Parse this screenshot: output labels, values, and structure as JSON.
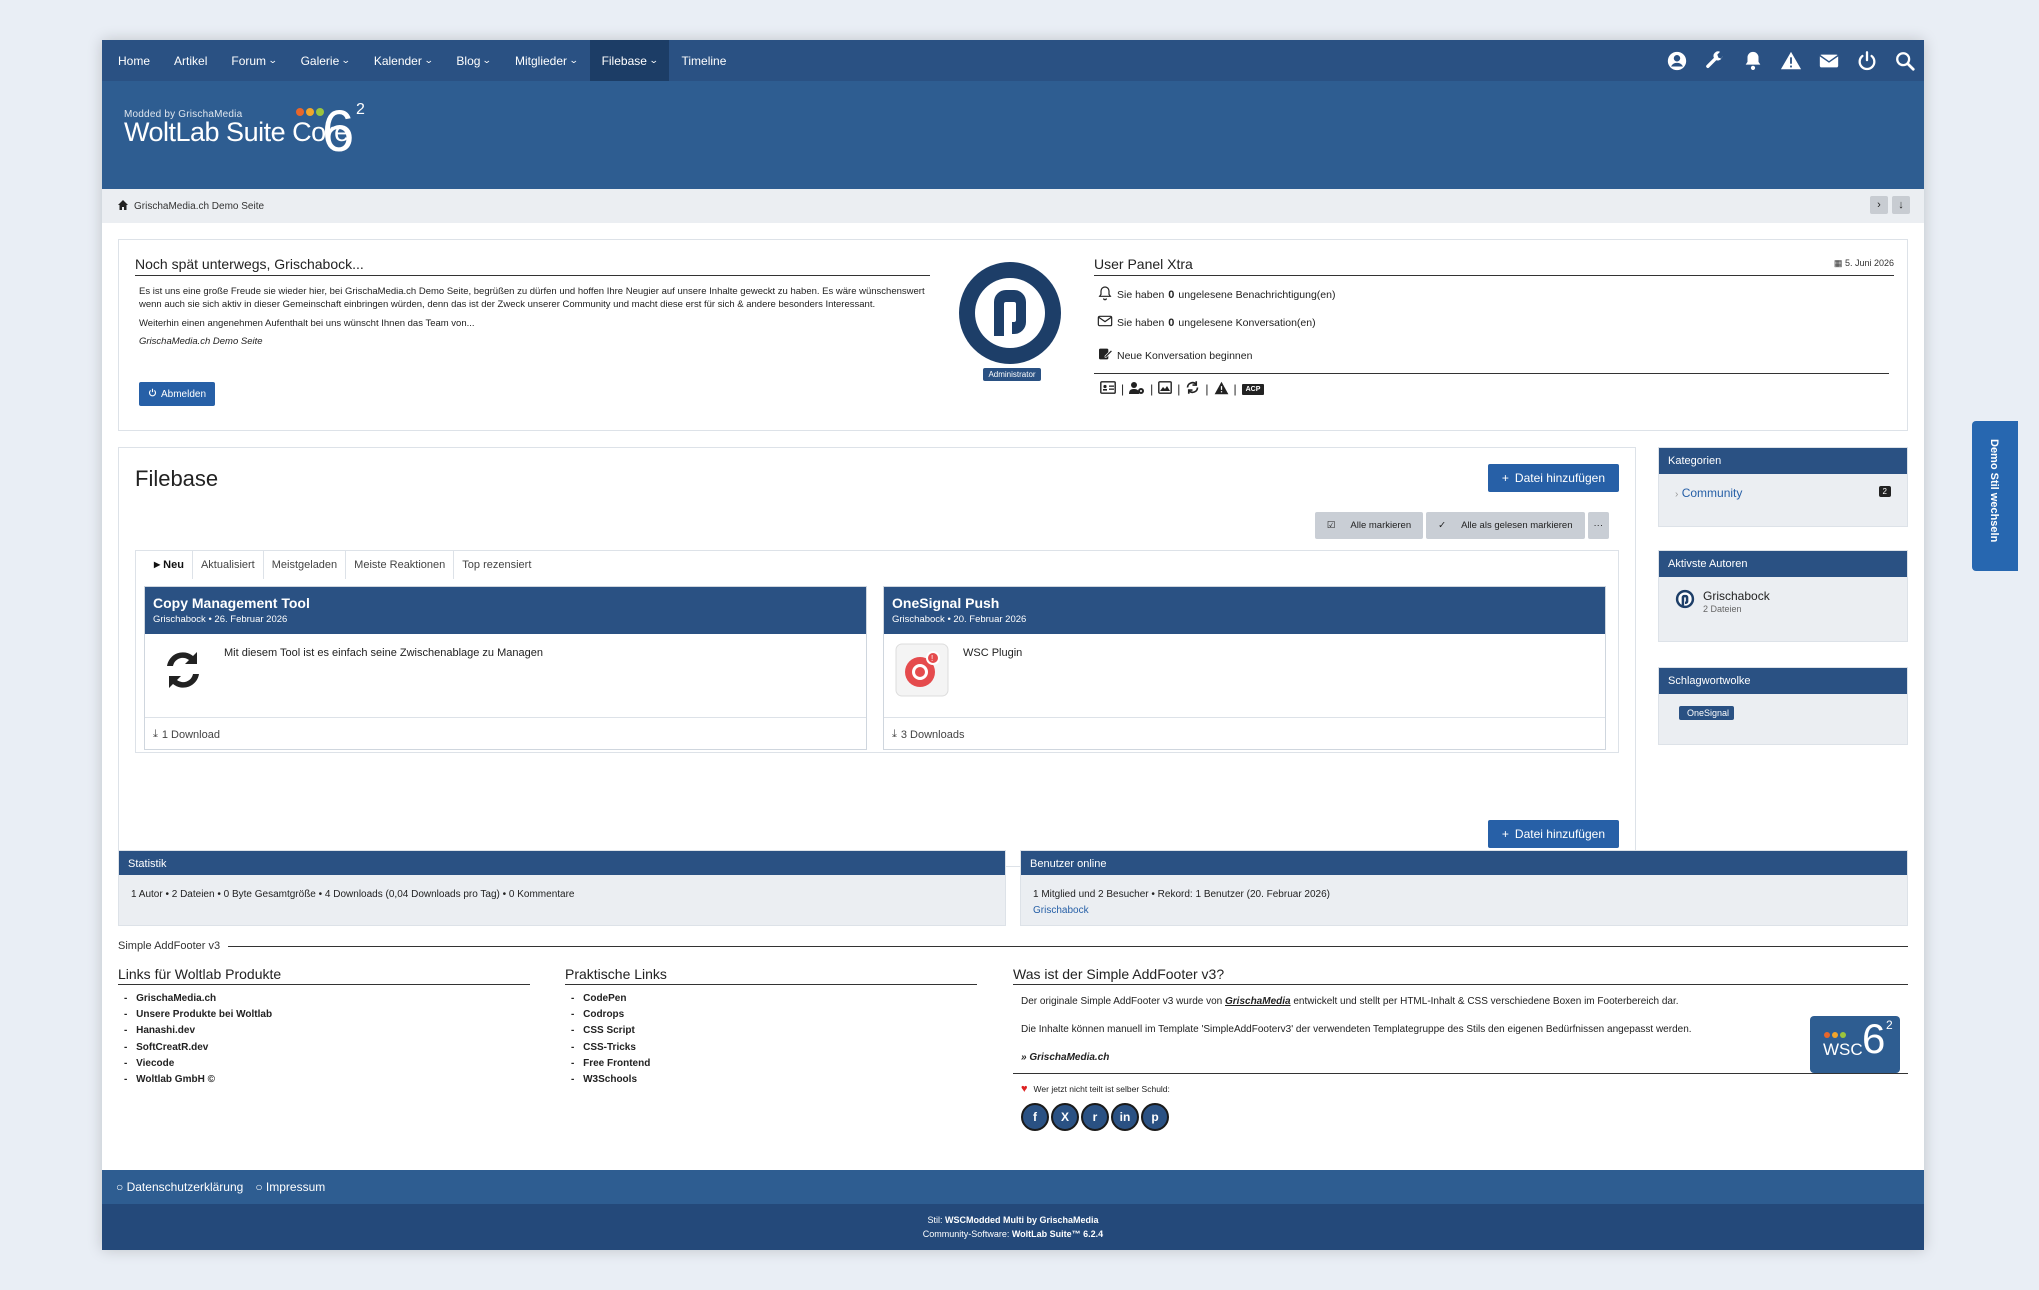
{
  "nav": {
    "items": [
      {
        "label": "Home",
        "chevron": false
      },
      {
        "label": "Artikel",
        "chevron": false
      },
      {
        "label": "Forum",
        "chevron": true
      },
      {
        "label": "Galerie",
        "chevron": true
      },
      {
        "label": "Kalender",
        "chevron": true
      },
      {
        "label": "Blog",
        "chevron": true
      },
      {
        "label": "Mitglieder",
        "chevron": true
      },
      {
        "label": "Filebase",
        "chevron": true,
        "active": true
      },
      {
        "label": "Timeline",
        "chevron": false
      }
    ],
    "icons": [
      "user-icon",
      "wrench-icon",
      "bell-icon",
      "warning-icon",
      "envelope-icon",
      "power-icon",
      "search-icon"
    ]
  },
  "logo": {
    "small": "Modded by GrischaMedia",
    "big": "WoltLab Suite Core",
    "version": "6",
    "sup": "2"
  },
  "breadcrumb": {
    "home": "GrischaMedia.ch Demo Seite"
  },
  "welcome": {
    "title": "Noch spät unterwegs, Grischabock...",
    "p1": "Es ist uns eine große Freude sie wieder hier, bei GrischaMedia.ch Demo Seite, begrüßen zu dürfen und hoffen Ihre Neugier auf unsere Inhalte geweckt zu haben. Es wäre wünschenswert wenn auch sie sich aktiv in dieser Gemeinschaft einbringen würden, denn das ist der Zweck unserer Community und macht diese erst für sich & andere besonders Interessant.",
    "p2": "Weiterhin einen angenehmen Aufenthalt bei uns wünscht Ihnen das Team von...",
    "sig": "GrischaMedia.ch Demo Seite",
    "logout": "Abmelden",
    "badge": "Administrator"
  },
  "userpanel": {
    "title": "User Panel Xtra",
    "date": "5. Juni 2026",
    "notif_pre": "Sie haben",
    "notif_count": "0",
    "notif_post": "ungelesene Benachrichtigung(en)",
    "conv_pre": "Sie haben",
    "conv_count": "0",
    "conv_post": "ungelesene Konversation(en)",
    "newconv": "Neue Konversation beginnen",
    "acp": "ACP"
  },
  "filebase": {
    "title": "Filebase",
    "add": "Datei hinzufügen",
    "mark_all": "Alle markieren",
    "mark_read": "Alle als gelesen markieren",
    "more": "···",
    "tabs": [
      "Neu",
      "Aktualisiert",
      "Meistgeladen",
      "Meiste Reaktionen",
      "Top rezensiert"
    ],
    "cards": [
      {
        "title": "Copy Management Tool",
        "author": "Grischabock",
        "date": "26. Februar 2026",
        "desc": "Mit diesem Tool ist es einfach seine Zwischenablage zu Managen",
        "downloads": "1 Download",
        "icon": "refresh-arrows-icon"
      },
      {
        "title": "OneSignal Push",
        "author": "Grischabock",
        "date": "20. Februar 2026",
        "desc": "WSC Plugin",
        "downloads": "3 Downloads",
        "icon": "onesignal-icon"
      }
    ]
  },
  "sidebar": {
    "categories": {
      "title": "Kategorien",
      "item": "Community",
      "count": "2"
    },
    "authors": {
      "title": "Aktivste Autoren",
      "name": "Grischabock",
      "files": "2 Dateien"
    },
    "tags": {
      "title": "Schlagwortwolke",
      "tag": "OneSignal"
    }
  },
  "stats": {
    "title": "Statistik",
    "text": "1 Autor  •  2 Dateien  •  0 Byte Gesamtgröße  •  4 Downloads (0,04 Downloads pro Tag)  •  0 Kommentare"
  },
  "online": {
    "title": "Benutzer online",
    "text": "1 Mitglied und 2 Besucher  •  Rekord: 1 Benutzer (20. Februar 2026)",
    "user": "Grischabock"
  },
  "addfooter": {
    "title": "Simple AddFooter v3",
    "col1": {
      "head": "Links für Woltlab Produkte",
      "items": [
        "GrischaMedia.ch",
        "Unsere Produkte bei Woltlab",
        "Hanashi.dev",
        "SoftCreatR.dev",
        "Viecode",
        "Woltlab GmbH ©"
      ]
    },
    "col2": {
      "head": "Praktische Links",
      "items": [
        "CodePen",
        "Codrops",
        "CSS Script",
        "CSS-Tricks",
        "Free Frontend",
        "W3Schools"
      ]
    },
    "col3": {
      "head": "Was ist der Simple AddFooter v3?",
      "p1_pre": "Der originale Simple AddFooter v3 wurde von ",
      "p1_brand": "GrischaMedia",
      "p1_post": " entwickelt und stellt per HTML-Inhalt & CSS verschiedene Boxen im Footerbereich dar.",
      "p2": "Die Inhalte können manuell im Template 'SimpleAddFooterv3' der verwendeten Templategruppe des Stils den eigenen Bedürfnissen angepasst werden.",
      "link": "» GrischaMedia.ch",
      "share": "Wer jetzt nicht teilt ist selber Schuld:",
      "share_icons": [
        "facebook-icon",
        "x-icon",
        "reddit-icon",
        "linkedin-icon",
        "pinterest-icon"
      ],
      "badge": "WSC"
    }
  },
  "bottom": {
    "privacy": "Datenschutzerklärung",
    "imprint": "Impressum"
  },
  "copyright": {
    "style_pre": "Stil: ",
    "style": "WSCModded Multi by GrischaMedia",
    "software_pre": "Community-Software: ",
    "software": "WoltLab Suite™ 6.2.4"
  },
  "demo": {
    "label": "Demo Stil wechseln"
  },
  "colors": {
    "nav": "#2a5183",
    "header": "#2e5d91",
    "primary": "#2760a7",
    "demo": "#2767b0"
  }
}
